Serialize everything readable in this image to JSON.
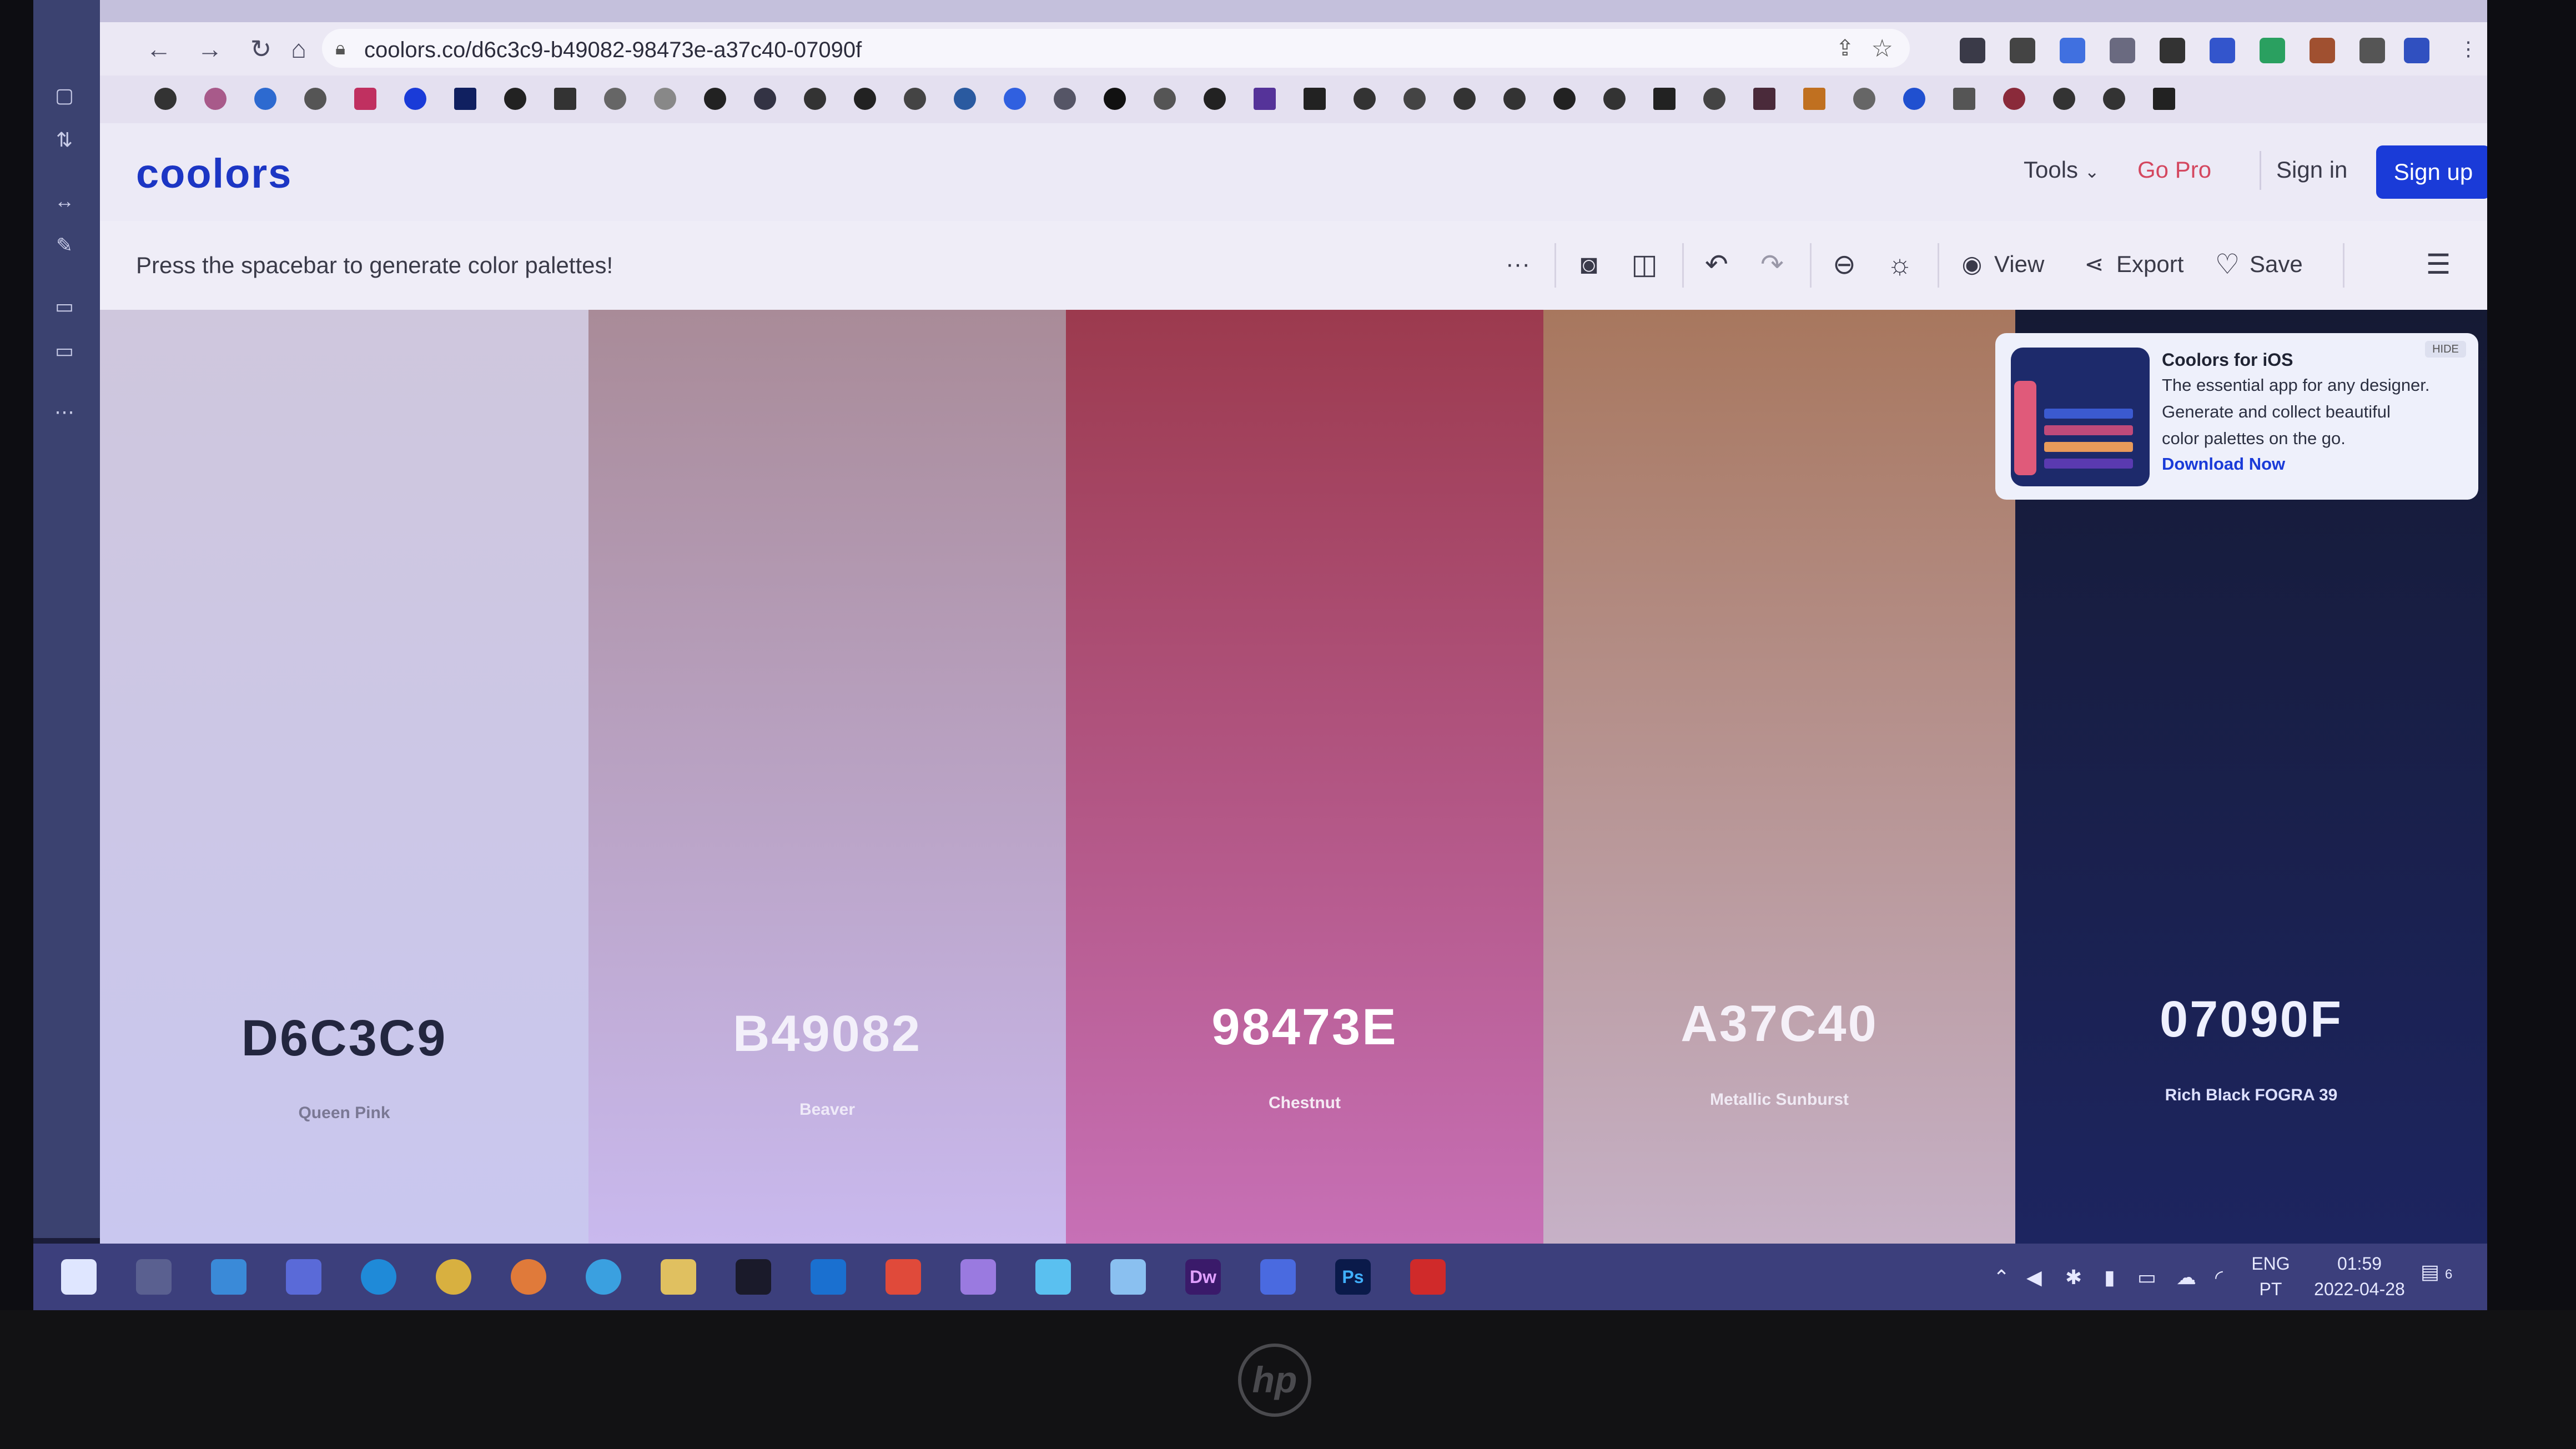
{
  "browser": {
    "url": "coolors.co/d6c3c9-b49082-98473e-a37c40-07090f",
    "nav": {
      "back_icon": "back-arrow-icon",
      "forward_icon": "forward-arrow-icon",
      "reload_icon": "reload-icon",
      "home_icon": "home-icon"
    }
  },
  "site": {
    "logo": "coolors",
    "header": {
      "tools": "Tools",
      "go_pro": "Go Pro",
      "sign_in": "Sign in",
      "sign_up": "Sign up"
    },
    "toolbar": {
      "hint": "Press the spacebar to generate color palettes!",
      "more": "···",
      "view": "View",
      "export": "Export",
      "save": "Save"
    },
    "palette": [
      {
        "hex": "D6C3C9",
        "name": "Queen Pink",
        "color": "#d6c3c9"
      },
      {
        "hex": "B49082",
        "name": "Beaver",
        "color": "#b49082"
      },
      {
        "hex": "98473E",
        "name": "Chestnut",
        "color": "#98473e"
      },
      {
        "hex": "A37C40",
        "name": "Metallic Sunburst",
        "color": "#a37c40"
      },
      {
        "hex": "07090F",
        "name": "Rich Black FOGRA 39",
        "color": "#07090f"
      }
    ],
    "promo": {
      "title": "Coolors for iOS",
      "line1": "The essential app for any designer.",
      "line2": "Generate and collect beautiful",
      "line3": "color palettes on the go.",
      "link": "Download Now",
      "hide": "HIDE"
    }
  },
  "taskbar": {
    "language": "ENG",
    "region": "PT",
    "time": "01:59",
    "date": "2022-04-28",
    "notifications": "6",
    "apps": [
      "start-icon",
      "task-view-icon",
      "store-icon",
      "teams-icon",
      "edge-icon",
      "chrome-icon",
      "firefox-icon",
      "ie-icon",
      "file-explorer-icon",
      "terminal-icon",
      "outlook-icon",
      "office-icon",
      "paint-icon",
      "notepad-icon",
      "files-icon",
      "dreamweaver-icon",
      "teams-chat-icon",
      "photoshop-icon",
      "acrobat-icon"
    ],
    "dreamweaver_label": "Dw",
    "photoshop_label": "Ps"
  },
  "colors": {
    "brand": "#1a3bd8",
    "go_pro": "#d4475f",
    "taskbar": "#3c3f7c"
  }
}
